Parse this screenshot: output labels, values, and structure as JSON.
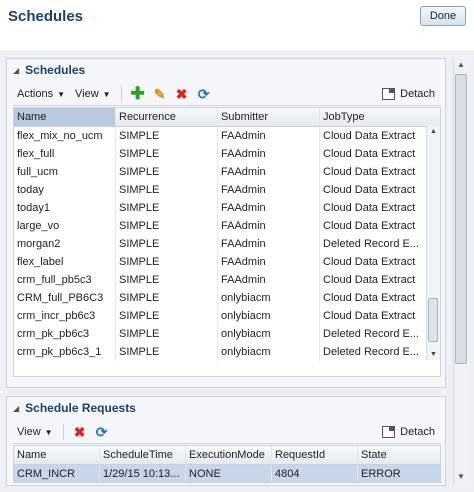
{
  "page": {
    "title": "Schedules",
    "done_label": "Done"
  },
  "schedules_panel": {
    "title": "Schedules",
    "toolbar": {
      "actions_label": "Actions",
      "view_label": "View",
      "detach_label": "Detach"
    },
    "columns": [
      "Name",
      "Recurrence",
      "Submitter",
      "JobType"
    ],
    "rows": [
      [
        "flex_mix_no_ucm",
        "SIMPLE",
        "FAAdmin",
        "Cloud Data Extract"
      ],
      [
        "flex_full",
        "SIMPLE",
        "FAAdmin",
        "Cloud Data Extract"
      ],
      [
        "full_ucm",
        "SIMPLE",
        "FAAdmin",
        "Cloud Data Extract"
      ],
      [
        "today",
        "SIMPLE",
        "FAAdmin",
        "Cloud Data Extract"
      ],
      [
        "today1",
        "SIMPLE",
        "FAAdmin",
        "Cloud Data Extract"
      ],
      [
        "large_vo",
        "SIMPLE",
        "FAAdmin",
        "Cloud Data Extract"
      ],
      [
        "morgan2",
        "SIMPLE",
        "FAAdmin",
        "Deleted Record E..."
      ],
      [
        "flex_label",
        "SIMPLE",
        "FAAdmin",
        "Cloud Data Extract"
      ],
      [
        "crm_full_pb5c3",
        "SIMPLE",
        "FAAdmin",
        "Cloud Data Extract"
      ],
      [
        "CRM_full_PB6C3",
        "SIMPLE",
        "onlybiacm",
        "Cloud Data Extract"
      ],
      [
        "crm_incr_pb6c3",
        "SIMPLE",
        "onlybiacm",
        "Cloud Data Extract"
      ],
      [
        "crm_pk_pb6c3",
        "SIMPLE",
        "onlybiacm",
        "Deleted Record E..."
      ],
      [
        "crm_pk_pb6c3_1",
        "SIMPLE",
        "onlybiacm",
        "Deleted Record E..."
      ]
    ]
  },
  "requests_panel": {
    "title": "Schedule Requests",
    "toolbar": {
      "view_label": "View",
      "detach_label": "Detach"
    },
    "columns": [
      "Name",
      "ScheduleTime",
      "ExecutionMode",
      "RequestId",
      "State"
    ],
    "rows": [
      [
        "CRM_INCR",
        "1/29/15 10:13...",
        "NONE",
        "4804",
        "ERROR"
      ]
    ]
  },
  "icons": {
    "add": "add-icon",
    "edit": "pencil-icon",
    "delete": "delete-x-icon",
    "refresh": "refresh-icon",
    "detach": "detach-icon"
  }
}
